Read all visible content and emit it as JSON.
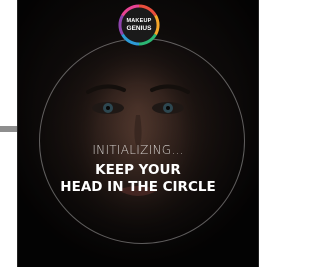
{
  "app": {
    "logo_line1": "MAKEUP",
    "logo_line2": "GENIUS",
    "brand_colors": [
      "#e94e3d",
      "#f4a62a",
      "#2bb673",
      "#2d9bd6",
      "#8e44ad",
      "#e84393"
    ]
  },
  "camera": {
    "status": "INITIALIZING...",
    "instruction_line1": "KEEP YOUR",
    "instruction_line2": "HEAD IN THE CIRCLE"
  },
  "icons": [
    "makeup-genius-logo-icon"
  ]
}
